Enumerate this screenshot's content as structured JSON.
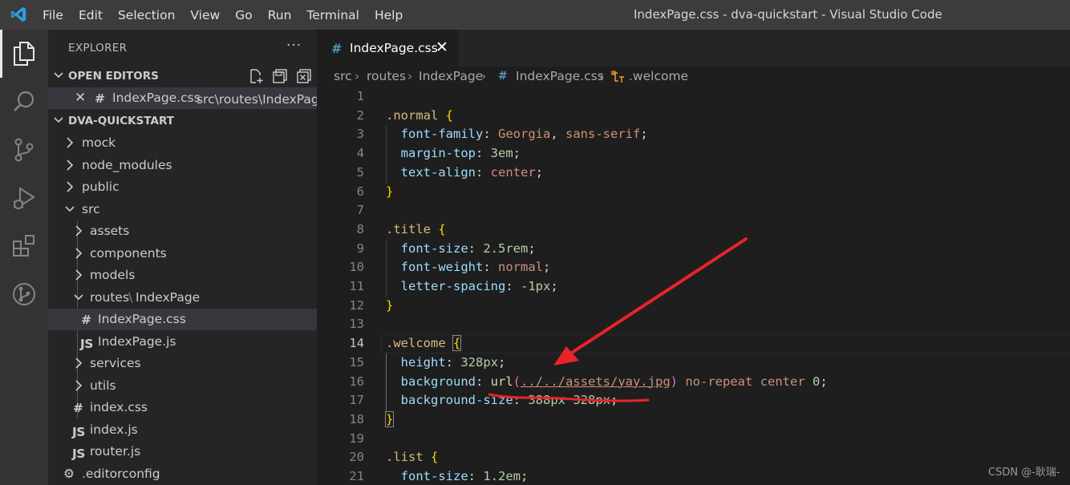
{
  "titlebar": {
    "menu": [
      "File",
      "Edit",
      "Selection",
      "View",
      "Go",
      "Run",
      "Terminal",
      "Help"
    ],
    "window_title": "IndexPage.css - dva-quickstart - Visual Studio Code"
  },
  "activitybar": {
    "items": [
      "explorer-icon",
      "search-icon",
      "source-control-icon",
      "run-debug-icon",
      "extensions-icon",
      "git-graph-icon"
    ]
  },
  "sidebar": {
    "title": "EXPLORER",
    "more": "···",
    "open_editors": {
      "label": "OPEN EDITORS",
      "items": [
        {
          "name": "IndexPage.css",
          "path": "src\\routes\\IndexPage"
        }
      ]
    },
    "project": {
      "label": "DVA-QUICKSTART",
      "tree": [
        {
          "label": "mock",
          "type": "folder"
        },
        {
          "label": "node_modules",
          "type": "folder"
        },
        {
          "label": "public",
          "type": "folder"
        },
        {
          "label": "src",
          "type": "folder-open"
        },
        {
          "label": "assets",
          "type": "folder"
        },
        {
          "label": "components",
          "type": "folder"
        },
        {
          "label": "models",
          "type": "folder"
        },
        {
          "label": "routes",
          "sep": "\\",
          "label2": "IndexPage",
          "type": "folder-open"
        },
        {
          "label": "IndexPage.css",
          "type": "css"
        },
        {
          "label": "IndexPage.js",
          "type": "js"
        },
        {
          "label": "services",
          "type": "folder"
        },
        {
          "label": "utils",
          "type": "folder"
        },
        {
          "label": "index.css",
          "type": "css"
        },
        {
          "label": "index.js",
          "type": "js"
        },
        {
          "label": "router.js",
          "type": "js"
        },
        {
          "label": ".editorconfig",
          "type": "config"
        }
      ],
      "hash_glyph": "#",
      "js_glyph": "JS"
    }
  },
  "editor": {
    "tab": {
      "label": "IndexPage.css",
      "close": "✕"
    },
    "breadcrumb": [
      "src",
      "routes",
      "IndexPage",
      "IndexPage.css",
      ".welcome"
    ],
    "lines": [
      {
        "n": "1"
      },
      {
        "n": "2"
      },
      {
        "n": "3"
      },
      {
        "n": "4"
      },
      {
        "n": "5"
      },
      {
        "n": "6"
      },
      {
        "n": "7"
      },
      {
        "n": "8"
      },
      {
        "n": "9"
      },
      {
        "n": "10"
      },
      {
        "n": "11"
      },
      {
        "n": "12"
      },
      {
        "n": "13"
      },
      {
        "n": "14"
      },
      {
        "n": "15"
      },
      {
        "n": "16"
      },
      {
        "n": "17"
      },
      {
        "n": "18"
      },
      {
        "n": "19"
      },
      {
        "n": "20"
      },
      {
        "n": "21"
      }
    ],
    "code": {
      "l2": {
        "sel": ".normal",
        "brace": "{"
      },
      "l3": {
        "prop": "font-family",
        "val1": "Georgia",
        "val2": "sans-serif"
      },
      "l4": {
        "prop": "margin-top",
        "num": "3em"
      },
      "l5": {
        "prop": "text-align",
        "val": "center"
      },
      "l6": {
        "brace": "}"
      },
      "l8": {
        "sel": ".title",
        "brace": "{"
      },
      "l9": {
        "prop": "font-size",
        "num": "2.5rem"
      },
      "l10": {
        "prop": "font-weight",
        "val": "normal"
      },
      "l11": {
        "prop": "letter-spacing",
        "num": "-1px"
      },
      "l12": {
        "brace": "}"
      },
      "l14": {
        "sel": ".welcome",
        "brace": "{"
      },
      "l15": {
        "prop": "height",
        "num": "328px"
      },
      "l16": {
        "prop": "background",
        "fn": "url",
        "url": "../../assets/yay.jpg",
        "val1": "no-repeat",
        "val2": "center",
        "num": "0"
      },
      "l17": {
        "prop": "background-size",
        "num": "388px 328px"
      },
      "l18": {
        "brace": "}"
      },
      "l20": {
        "sel": ".list",
        "brace": "{"
      },
      "l21": {
        "prop": "font-size",
        "num": "1.2em"
      }
    },
    "annotation_color": "#e8232b"
  },
  "watermark": "CSDN @-耿瑞-"
}
